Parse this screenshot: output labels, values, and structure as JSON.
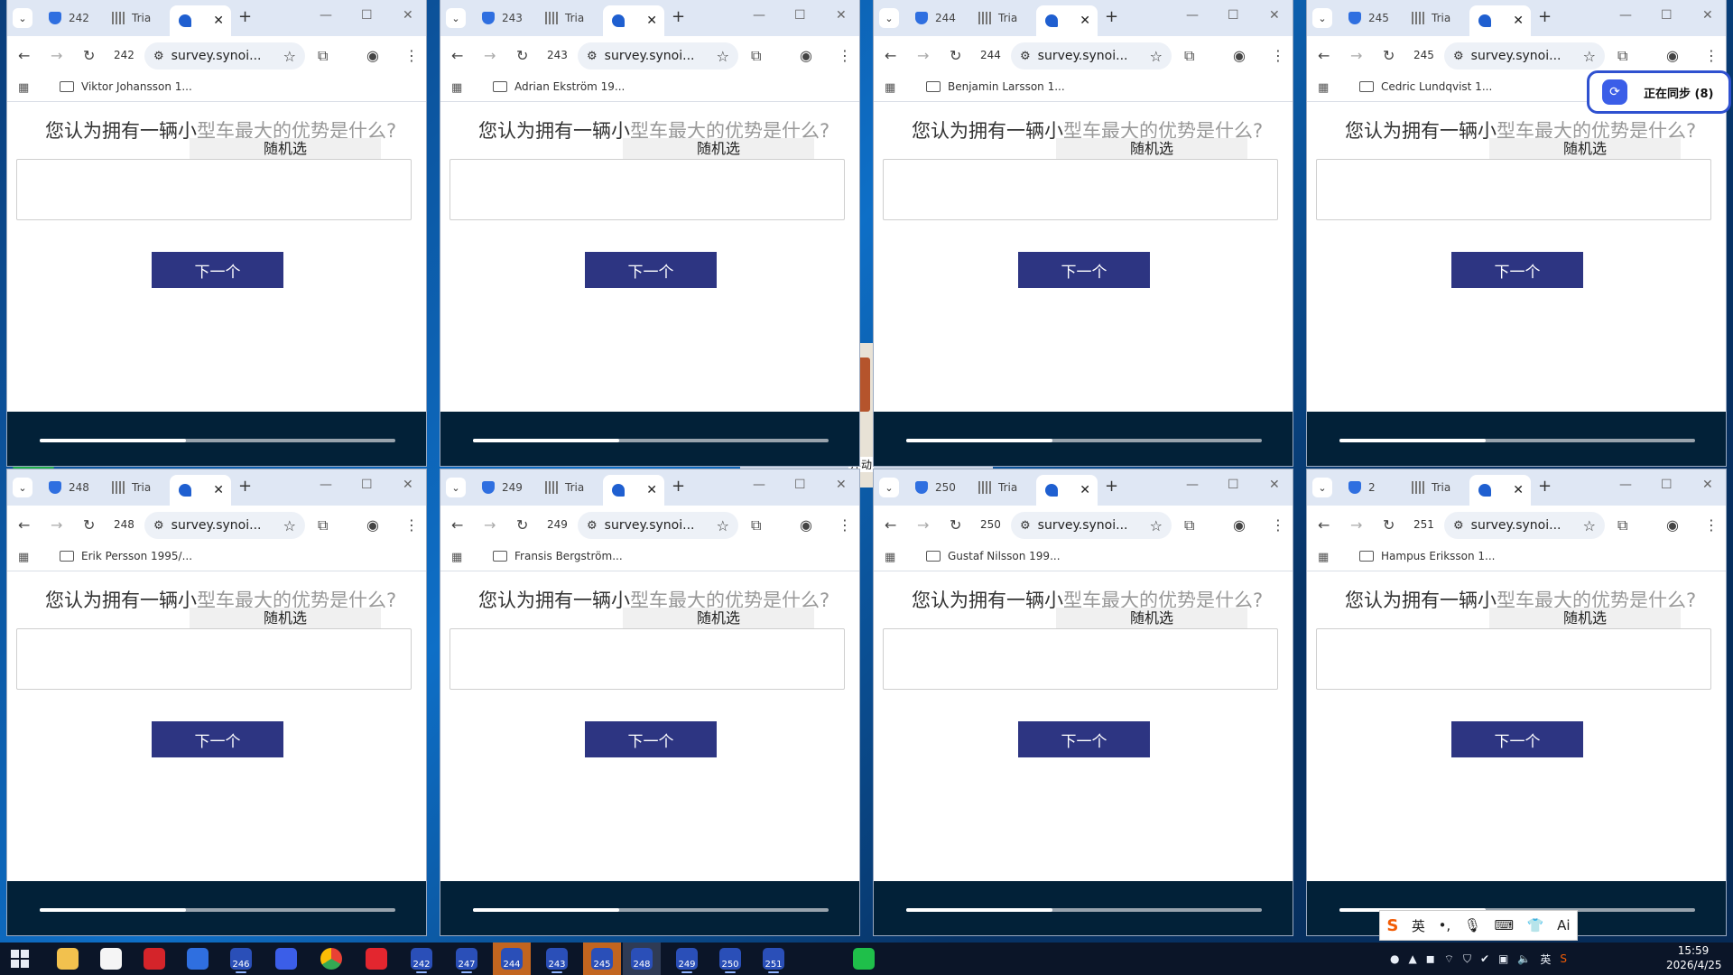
{
  "browser_common": {
    "tab2_label": "Tria",
    "url": "survey.synoi...",
    "question_main": "您认为拥有一辆小",
    "question_faded": "型车最大的优势是什么?",
    "chip_label": "随机选",
    "next_label": "下一个",
    "progress_fraction": 0.41
  },
  "windows": [
    {
      "tab_number": "242",
      "toolbar_number": "242",
      "bookmark": "Viktor Johansson 1..."
    },
    {
      "tab_number": "243",
      "toolbar_number": "243",
      "bookmark": "Adrian Ekström 19..."
    },
    {
      "tab_number": "244",
      "toolbar_number": "244",
      "bookmark": "Benjamin Larsson 1..."
    },
    {
      "tab_number": "245",
      "toolbar_number": "245",
      "bookmark": "Cedric Lundqvist 1..."
    },
    {
      "tab_number": "248",
      "toolbar_number": "248",
      "bookmark": "Erik Persson 1995/..."
    },
    {
      "tab_number": "249",
      "toolbar_number": "249",
      "bookmark": "Fransis Bergström..."
    },
    {
      "tab_number": "250",
      "toolbar_number": "250",
      "bookmark": "Gustaf Nilsson 199..."
    },
    {
      "tab_number": "2",
      "toolbar_number": "251",
      "bookmark": "Hampus Eriksson 1..."
    }
  ],
  "sync_badge": "正在同步 (8)",
  "desktop_label": "浮动",
  "ime": {
    "logo": "S",
    "lang": "英",
    "punct": "•,",
    "mic": "🎙",
    "keyboard": "⌨",
    "skin": "👕",
    "ai": "Ai"
  },
  "taskbar": {
    "badges": [
      "246",
      "242",
      "247",
      "244",
      "243",
      "245",
      "248",
      "249",
      "250",
      "251"
    ],
    "tray_lang": "英",
    "time": "15:59",
    "date": "2026/4/25"
  },
  "colors": {
    "next_button": "#2d3582",
    "footer": "#022138",
    "sync_border": "#2f51d0"
  }
}
